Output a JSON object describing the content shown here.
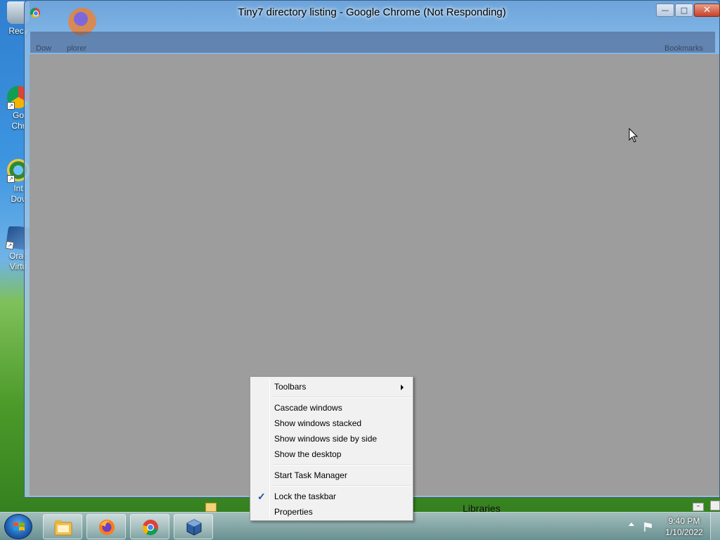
{
  "desktop": {
    "icons": [
      {
        "icon": "recycle-bin-icon",
        "label": "Recy"
      },
      {
        "icon": "google-chrome-icon",
        "label1": "Go",
        "label2": "Chr"
      },
      {
        "icon": "internet-download-icon",
        "label1": "Int",
        "label2": "Dov"
      },
      {
        "icon": "virtualbox-icon",
        "label1": "Orac",
        "label2": "Virtu"
      }
    ]
  },
  "window": {
    "title": "Tiny7 directory listing - Google Chrome (Not Responding)",
    "minimize_label": "—",
    "maximize_label": "□",
    "close_label": "✕",
    "ghost_left": "Dow",
    "ghost_left2": "plorer",
    "ghost_right": "Bookmarks"
  },
  "context_menu": {
    "items": [
      {
        "label": "Toolbars",
        "submenu": true
      },
      {
        "label": "Cascade windows"
      },
      {
        "label": "Show windows stacked"
      },
      {
        "label": "Show windows side by side"
      },
      {
        "label": "Show the desktop"
      },
      {
        "label": "Start Task Manager"
      },
      {
        "label": "Lock the taskbar",
        "checked": true
      },
      {
        "label": "Properties"
      }
    ]
  },
  "background_window": {
    "title": "Libraries"
  },
  "taskbar": {
    "pinned": [
      "windows-explorer-icon",
      "firefox-icon",
      "chrome-icon",
      "virtualbox-icon"
    ],
    "clock_time": "9:40 PM",
    "clock_date": "1/10/2022"
  },
  "colors": {
    "content_gray": "#9d9d9d",
    "menu_bg": "#f1f1f1",
    "close_red": "#c7412a"
  }
}
